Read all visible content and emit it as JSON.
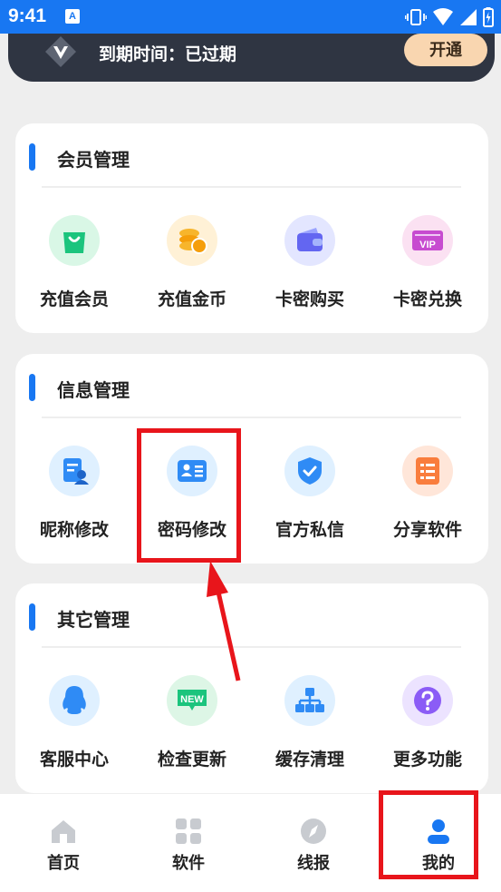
{
  "status_bar": {
    "time": "9:41",
    "notif_glyph": "A"
  },
  "member": {
    "expire_text": "到期时间：已过期",
    "open_label": "开通"
  },
  "sections": [
    {
      "title": "会员管理",
      "items": [
        {
          "label": "充值会员",
          "icon": "shopping-bag-icon",
          "bg": "#d9f7e6"
        },
        {
          "label": "充值金币",
          "icon": "coins-icon",
          "bg": "#fff1d6"
        },
        {
          "label": "卡密购买",
          "icon": "wallet-icon",
          "bg": "#e3e6ff"
        },
        {
          "label": "卡密兑换",
          "icon": "vip-ticket-icon",
          "bg": "#fbe1f2"
        }
      ]
    },
    {
      "title": "信息管理",
      "items": [
        {
          "label": "昵称修改",
          "icon": "profile-edit-icon",
          "bg": "#dff0ff"
        },
        {
          "label": "密码修改",
          "icon": "id-card-icon",
          "bg": "#dff0ff"
        },
        {
          "label": "官方私信",
          "icon": "shield-check-icon",
          "bg": "#dff0ff"
        },
        {
          "label": "分享软件",
          "icon": "list-icon",
          "bg": "#ffe6d9"
        }
      ]
    },
    {
      "title": "其它管理",
      "items": [
        {
          "label": "客服中心",
          "icon": "qq-penguin-icon",
          "bg": "#dff0ff"
        },
        {
          "label": "检查更新",
          "icon": "new-badge-icon",
          "bg": "#ddf6e6"
        },
        {
          "label": "缓存清理",
          "icon": "sitemap-icon",
          "bg": "#dff0ff"
        },
        {
          "label": "更多功能",
          "icon": "question-icon",
          "bg": "#ece3ff"
        }
      ]
    }
  ],
  "bottom_nav": [
    {
      "label": "首页",
      "icon": "home-icon",
      "active": false
    },
    {
      "label": "软件",
      "icon": "grid-icon",
      "active": false
    },
    {
      "label": "线报",
      "icon": "compass-icon",
      "active": false
    },
    {
      "label": "我的",
      "icon": "user-icon",
      "active": true
    }
  ],
  "colors": {
    "accent": "#1877f2",
    "annotation": "#e8151b",
    "inactive_nav": "#c8cbd0"
  }
}
